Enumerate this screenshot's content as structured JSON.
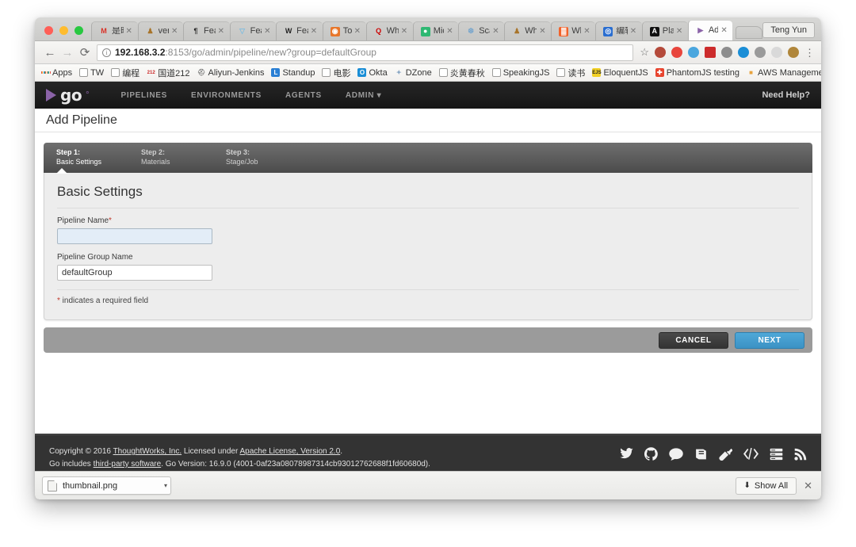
{
  "browser": {
    "profile_label": "Teng Yun",
    "url": {
      "host": "192.168.3.2",
      "rest": ":8153/go/admin/pipeline/new?group=defaultGroup"
    },
    "nav": {
      "back": "←",
      "forward": "→",
      "reload": "⟳",
      "star": "☆",
      "menu": "⋮",
      "info": "i"
    },
    "tabs": [
      {
        "label": "是时",
        "fav": "M",
        "fav_color": "#d93025",
        "fav_bg": "transparent",
        "active": false
      },
      {
        "label": "vers",
        "fav": "♟",
        "fav_color": "#a8742a",
        "fav_bg": "transparent",
        "active": false
      },
      {
        "label": "Feat",
        "fav": "¶",
        "fav_color": "#222222",
        "fav_bg": "transparent",
        "active": false
      },
      {
        "label": "Feat",
        "fav": "▽",
        "fav_color": "#7fbde0",
        "fav_bg": "transparent",
        "active": false
      },
      {
        "label": "Feat",
        "fav": "W",
        "fav_color": "#222222",
        "fav_bg": "transparent",
        "active": false
      },
      {
        "label": "Top",
        "fav": "◉",
        "fav_color": "#ffffff",
        "fav_bg": "#e8762a",
        "active": false
      },
      {
        "label": "Wha",
        "fav": "Q",
        "fav_color": "#cc0000",
        "fav_bg": "transparent",
        "active": false
      },
      {
        "label": "Micr",
        "fav": "●",
        "fav_color": "#ffffff",
        "fav_bg": "#2eb872",
        "active": false
      },
      {
        "label": "Scal",
        "fav": "❆",
        "fav_color": "#7aa7cc",
        "fav_bg": "transparent",
        "active": false
      },
      {
        "label": "Wha",
        "fav": "♟",
        "fav_color": "#a8742a",
        "fav_bg": "transparent",
        "active": false
      },
      {
        "label": "Whi",
        "fav": "▓",
        "fav_color": "#ffffff",
        "fav_bg": "#f2622a",
        "active": false
      },
      {
        "label": "编辑",
        "fav": "◎",
        "fav_color": "#ffffff",
        "fav_bg": "#2a6ed1",
        "active": false
      },
      {
        "label": "Play",
        "fav": "A",
        "fav_color": "#ffffff",
        "fav_bg": "#111111",
        "active": false
      },
      {
        "label": "Add",
        "fav": "▶",
        "fav_color": "#8b63a8",
        "fav_bg": "transparent",
        "active": true
      }
    ],
    "extensions": [
      "#b44a3a",
      "#e8453c",
      "#4aa6de",
      "#cc2b2b",
      "#8d8d8d",
      "#1b8ed6",
      "#9a9a9a",
      "#d9d9d9",
      "#b0863a"
    ],
    "bookmarks": [
      {
        "label": "Apps",
        "icon": "apps-grid"
      },
      {
        "label": "TW",
        "icon": "folder"
      },
      {
        "label": "编程",
        "icon": "folder"
      },
      {
        "label": "国道212",
        "icon": "212",
        "icon_color": "#cc2b2b"
      },
      {
        "label": "Aliyun-Jenkins",
        "icon": "⛑",
        "icon_color": "#7a7a7a"
      },
      {
        "label": "Standup",
        "icon": "L",
        "icon_color": "#ffffff",
        "icon_bg": "#2a7fd4"
      },
      {
        "label": "电影",
        "icon": "page"
      },
      {
        "label": "Okta",
        "icon": "O",
        "icon_color": "#ffffff",
        "icon_bg": "#1b8ed6"
      },
      {
        "label": "DZone",
        "icon": "✦",
        "icon_color": "#8aa7c4"
      },
      {
        "label": "炎黄春秋",
        "icon": "page"
      },
      {
        "label": "SpeakingJS",
        "icon": "page"
      },
      {
        "label": "读书",
        "icon": "page"
      },
      {
        "label": "EloquentJS",
        "icon": "EJS",
        "icon_color": "#222222",
        "icon_bg": "#f2d024"
      },
      {
        "label": "PhantomJS testing",
        "icon": "✚",
        "icon_color": "#ffffff",
        "icon_bg": "#e8452f"
      },
      {
        "label": "AWS Management C...",
        "icon": "■",
        "icon_color": "#e8a33d"
      }
    ],
    "bookmarks_overflow": "»"
  },
  "app": {
    "brand": {
      "word": "go",
      "dot": "°"
    },
    "nav": [
      "PIPELINES",
      "ENVIRONMENTS",
      "AGENTS",
      "ADMIN ▾"
    ],
    "need_help": "Need Help?",
    "page_title": "Add Pipeline",
    "steps": [
      {
        "number": "Step 1:",
        "name": "Basic Settings",
        "active": true
      },
      {
        "number": "Step 2:",
        "name": "Materials",
        "active": false
      },
      {
        "number": "Step 3:",
        "name": "Stage/Job",
        "active": false
      }
    ],
    "form": {
      "heading": "Basic Settings",
      "fields": [
        {
          "label": "Pipeline Name",
          "required": true,
          "value": "",
          "focused": true
        },
        {
          "label": "Pipeline Group Name",
          "required": false,
          "value": "defaultGroup",
          "focused": false
        }
      ],
      "required_hint_star": "*",
      "required_hint": " indicates a required field"
    },
    "buttons": {
      "cancel": "CANCEL",
      "next": "NEXT"
    },
    "footer": {
      "line1_a": "Copyright © 2016 ",
      "line1_link1": "ThoughtWorks, Inc.",
      "line1_b": " Licensed under ",
      "line1_link2": "Apache License, Version 2.0",
      "line1_c": ".",
      "line2_a": "Go includes ",
      "line2_link": "third-party software",
      "line2_b": ". Go Version: 16.9.0 (4001-0af23a08078987314cb93012762688f1fd60680d).",
      "icons": [
        "twitter-icon",
        "github-icon",
        "chat-icon",
        "book-icon",
        "plug-icon",
        "code-icon",
        "server-icon",
        "rss-icon"
      ]
    },
    "colors": {
      "accent": "#8b63a8",
      "next_button": "#4fa8d8",
      "header_bg": "#1c1c1c",
      "footer_bg": "#333333"
    }
  },
  "download_shelf": {
    "file_name": "thumbnail.png",
    "caret": "▾",
    "show_all": "Show All",
    "download_icon": "⬇",
    "close": "✕"
  }
}
